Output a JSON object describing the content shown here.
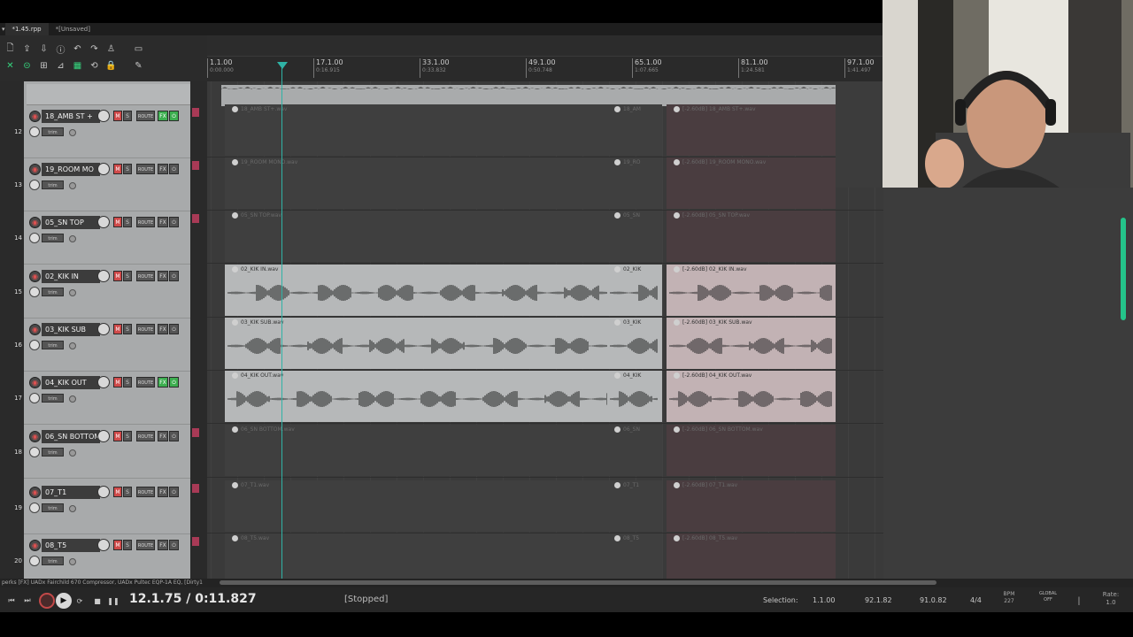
{
  "tabs": [
    {
      "label": "*1.45.rpp",
      "active": true
    },
    {
      "label": "*[Unsaved]",
      "active": false
    }
  ],
  "ruler": [
    {
      "bar": "1.1.00",
      "time": "0:00.000"
    },
    {
      "bar": "17.1.00",
      "time": "0:16.915"
    },
    {
      "bar": "33.1.00",
      "time": "0:33.832"
    },
    {
      "bar": "49.1.00",
      "time": "0:50.748"
    },
    {
      "bar": "65.1.00",
      "time": "1:07.665"
    },
    {
      "bar": "81.1.00",
      "time": "1:24.581"
    },
    {
      "bar": "97.1.00",
      "time": "1:41.497"
    }
  ],
  "tracks": [
    {
      "num": "12",
      "name": "18_AMB ST +",
      "fx_on": true,
      "has_audio": false,
      "label_a": "18_AMB ST+.wav",
      "label_b": "18_AM",
      "label_c": "[-2.60dB] 18_AMB ST+.wav"
    },
    {
      "num": "13",
      "name": "19_ROOM MO",
      "fx_on": false,
      "has_audio": false,
      "label_a": "19_ROOM MONO.wav",
      "label_b": "19_RO",
      "label_c": "[-2.60dB] 19_ROOM MONO.wav"
    },
    {
      "num": "14",
      "name": "05_SN TOP",
      "fx_on": false,
      "has_audio": false,
      "label_a": "05_SN TOP.wav",
      "label_b": "05_SN",
      "label_c": "[-2.60dB] 05_SN TOP.wav"
    },
    {
      "num": "15",
      "name": "02_KIK IN",
      "fx_on": false,
      "has_audio": true,
      "label_a": "02_KIK IN.wav",
      "label_b": "02_KIK",
      "label_c": "[-2.60dB] 02_KIK IN.wav"
    },
    {
      "num": "16",
      "name": "03_KIK SUB",
      "fx_on": false,
      "has_audio": true,
      "label_a": "03_KIK SUB.wav",
      "label_b": "03_KIK",
      "label_c": "[-2.60dB] 03_KIK SUB.wav"
    },
    {
      "num": "17",
      "name": "04_KIK OUT",
      "fx_on": true,
      "has_audio": true,
      "label_a": "04_KIK OUT.wav",
      "label_b": "04_KIK",
      "label_c": "[-2.60dB] 04_KIK OUT.wav"
    },
    {
      "num": "18",
      "name": "06_SN BOTTOM",
      "fx_on": false,
      "has_audio": false,
      "label_a": "06_SN BOTTOM.wav",
      "label_b": "06_SN",
      "label_c": "[-2.60dB] 06_SN BOTTOM.wav"
    },
    {
      "num": "19",
      "name": "07_T1",
      "fx_on": false,
      "has_audio": false,
      "label_a": "07_T1.wav",
      "label_b": "07_T1",
      "label_c": "[-2.60dB] 07_T1.wav"
    },
    {
      "num": "20",
      "name": "08_T5",
      "fx_on": false,
      "has_audio": false,
      "label_a": "08_T5.wav",
      "label_b": "08_T5",
      "label_c": "[-2.60dB] 08_T5.wav"
    }
  ],
  "track_buttons": {
    "mute": "M",
    "solo": "S",
    "route": "ROUTE",
    "fx": "FX",
    "fx_bypass": "⏻",
    "trim": "trim",
    "rec": "◉"
  },
  "fx_info": "perks [FX] UADx Fairchild 670 Compressor, UADx Pultec EQP-1A EQ, [Dirty1",
  "transport": {
    "time": "12.1.75 / 0:11.827",
    "status": "[Stopped]",
    "selection_label": "Selection:",
    "sel_start": "1.1.00",
    "sel_end": "92.1.82",
    "sel_len": "91.0.82",
    "time_sig": "4/4",
    "bpm_label": "BPM",
    "bpm": "227",
    "global_label": "GLOBAL",
    "global_state": "OFF",
    "rate_label": "Rate:",
    "rate": "1.0"
  },
  "colors": {
    "accent_green": "#24c48a",
    "playhead": "#2fb3a6",
    "mute_red": "#d04a4a",
    "fx_green": "#3cae4f"
  }
}
